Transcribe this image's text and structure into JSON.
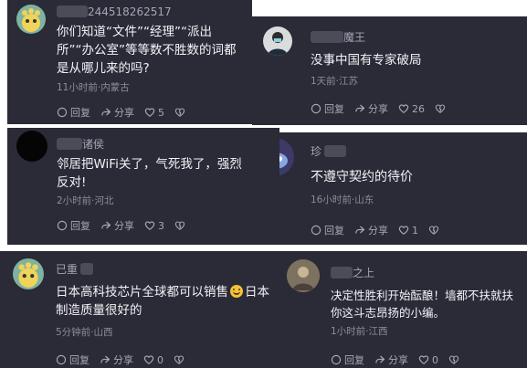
{
  "comments": [
    {
      "username": "244518262517",
      "content": "你们知道“文件”“经理”“派出所”“办公室”等等数不胜数的词都是从哪儿来的吗?",
      "meta": "11小时前·内蒙古",
      "reply_label": "回复",
      "share_label": "分享",
      "like_count": "5"
    },
    {
      "username": "魔王",
      "content": "没事中国有专家破局",
      "meta": "1天前·江苏",
      "reply_label": "回复",
      "share_label": "分享",
      "like_count": "26"
    },
    {
      "username": "诸侯",
      "content": "邻居把WiFi关了，气死我了，强烈反对!",
      "meta": "2小时前·河北",
      "reply_label": "回复",
      "share_label": "分享",
      "like_count": "3"
    },
    {
      "username": "珍",
      "content": "不遵守契约的待价",
      "meta": "16小时前·山东",
      "reply_label": "回复",
      "share_label": "分享",
      "like_count": "1"
    },
    {
      "username": "已重",
      "content": "日本高科技芯片全球都可以销售",
      "content_tail": "日本制造质量很好的",
      "meta": "5分钟前·山西",
      "reply_label": "回复",
      "share_label": "分享",
      "like_count": "0"
    },
    {
      "username": "之上",
      "content": "决定性胜利开始酝酿！墙都不扶就扶你这斗志昂扬的小编。",
      "meta": "1小时前·江西",
      "reply_label": "回复",
      "share_label": "分享",
      "like_count": "0"
    }
  ],
  "colors": {
    "card_bg": "#2b2a37",
    "page_bg": "#ffffff",
    "text": "#f2f2f6",
    "meta": "#8d8d9a"
  }
}
